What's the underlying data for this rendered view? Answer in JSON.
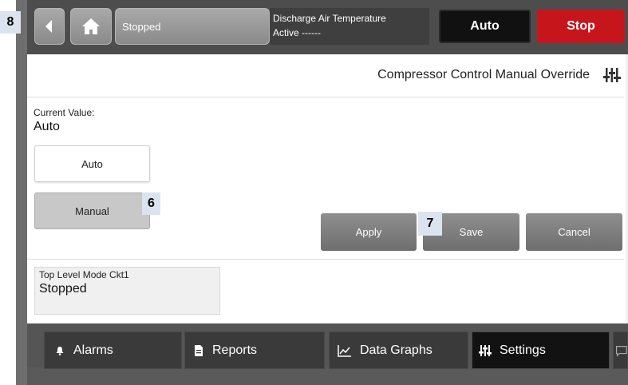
{
  "badges": {
    "b8": "8",
    "b6": "6",
    "b7": "7"
  },
  "topbar": {
    "status_text": "Stopped",
    "discharge_title": "Discharge Air Temperature",
    "discharge_status": "Active ------",
    "auto_label": "Auto",
    "stop_label": "Stop",
    "stop_color": "#c7161b"
  },
  "main": {
    "title": "Compressor Control Manual Override",
    "current_value_label": "Current Value:",
    "current_value": "Auto",
    "option_auto": "Auto",
    "option_manual": "Manual",
    "apply_label": "Apply",
    "save_label": "Save",
    "cancel_label": "Cancel",
    "info_label": "Top Level Mode Ckt1",
    "info_value": "Stopped"
  },
  "nav": {
    "alarms": "Alarms",
    "reports": "Reports",
    "graphs": "Data Graphs",
    "settings": "Settings"
  },
  "icons": [
    "back-icon",
    "home-icon",
    "settings-sliders-icon",
    "bell-icon",
    "report-icon",
    "graph-icon",
    "message-icon"
  ]
}
